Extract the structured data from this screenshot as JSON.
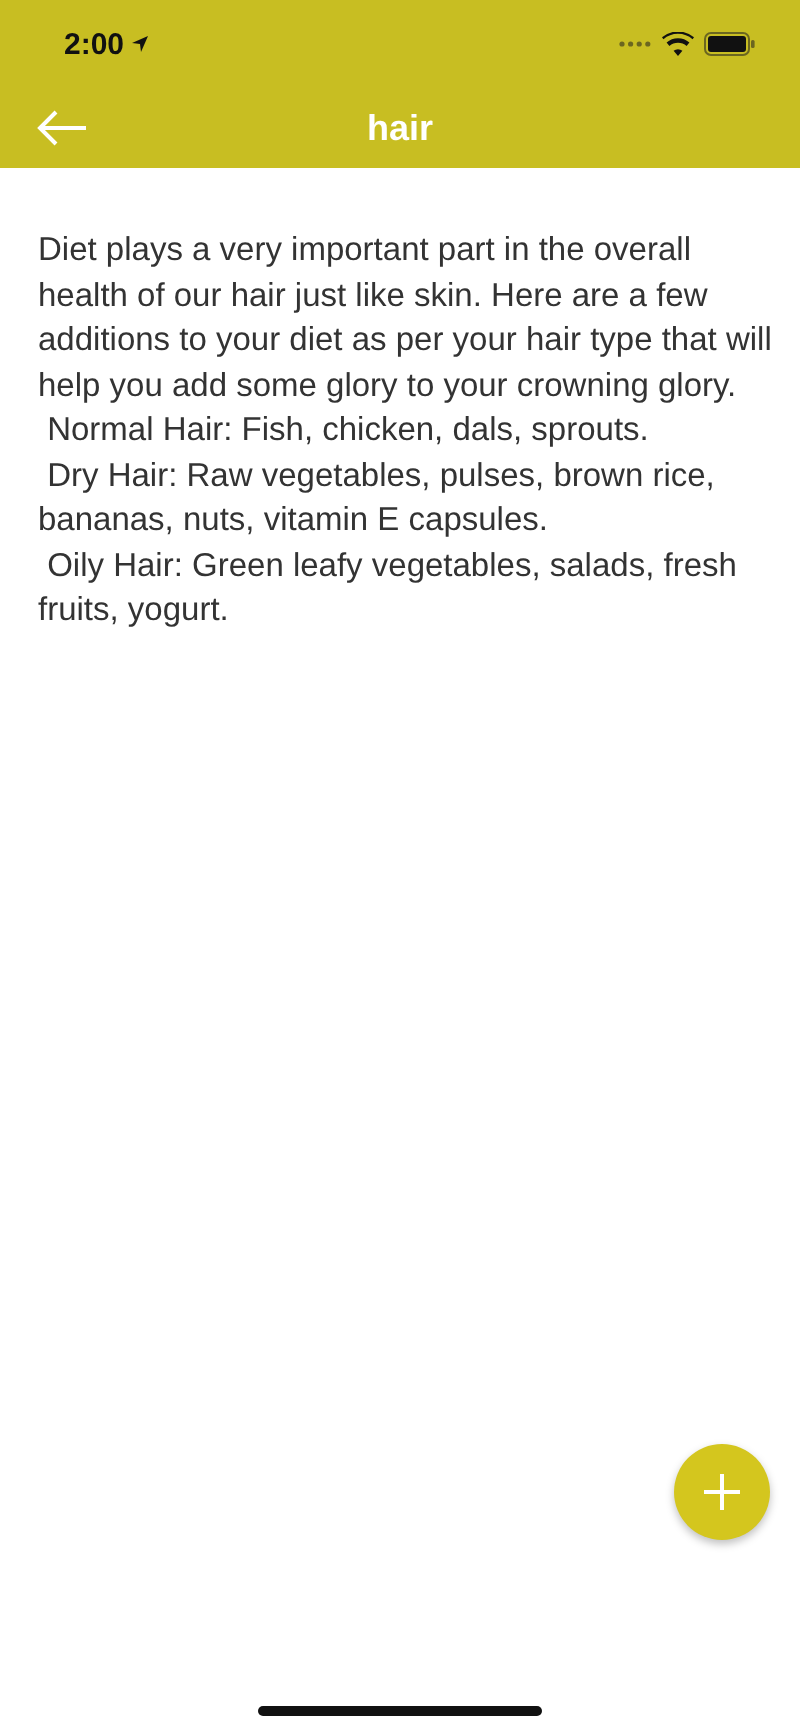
{
  "status_bar": {
    "time": "2:00"
  },
  "header": {
    "title": "hair"
  },
  "paragraphs": [
    "Diet plays a very important part in the overall health of our hair just like skin. Here are a few additions to your diet as per your hair type that will help you add some glory to your crowning glory.",
    " Normal Hair: Fish, chicken, dals, sprouts.",
    " Dry Hair: Raw vegetables, pulses, brown rice, bananas, nuts, vitamin E capsules.",
    " Oily Hair: Green leafy vegetables, salads, fresh fruits, yogurt."
  ]
}
